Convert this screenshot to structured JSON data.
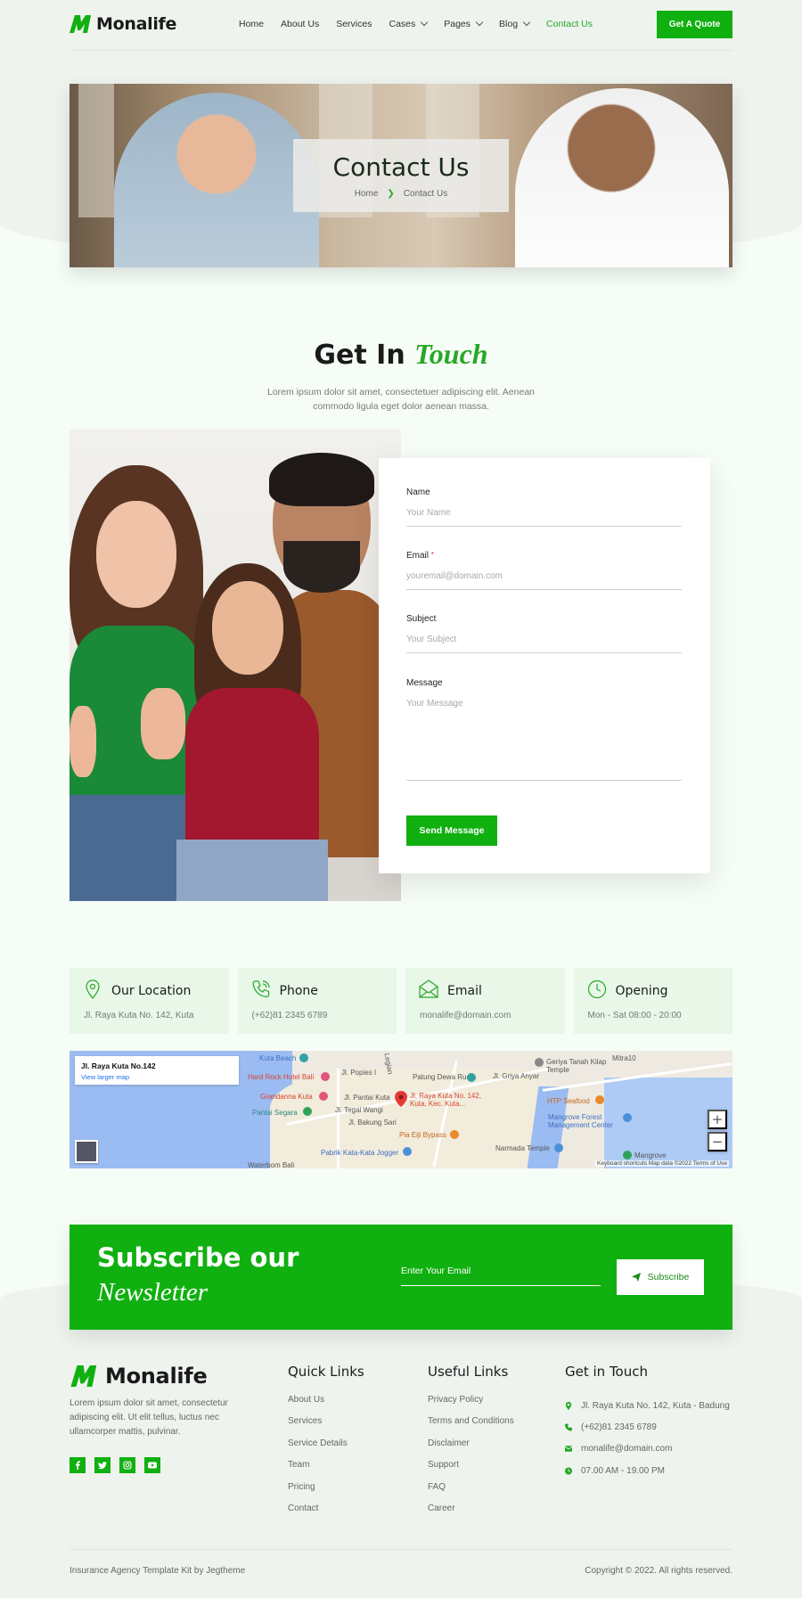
{
  "brand": {
    "name": "Monalife",
    "accent": "#10b010"
  },
  "nav": {
    "items": [
      {
        "label": "Home"
      },
      {
        "label": "About Us"
      },
      {
        "label": "Services"
      },
      {
        "label": "Cases"
      },
      {
        "label": "Pages"
      },
      {
        "label": "Blog"
      },
      {
        "label": "Contact Us"
      }
    ],
    "active": "Contact Us",
    "cta_label": "Get A Quote"
  },
  "hero": {
    "title": "Contact Us",
    "breadcrumb": [
      "Home",
      "Contact Us"
    ]
  },
  "get_in_touch": {
    "title": "Get In",
    "title_accent": "Touch",
    "description": "Lorem ipsum dolor sit amet, consectetuer adipiscing elit. Aenean commodo ligula eget dolor aenean massa."
  },
  "form": {
    "name_label": "Name",
    "name_placeholder": "Your Name",
    "email_label": "Email",
    "email_required_mark": "*",
    "email_placeholder": "youremail@domain.com",
    "subject_label": "Subject",
    "subject_placeholder": "Your Subject",
    "message_label": "Message",
    "message_placeholder": "Your Message",
    "submit_label": "Send Message"
  },
  "info_cards": [
    {
      "icon": "location-pin-icon",
      "title": "Our Location",
      "text": "Jl. Raya Kuta No. 142, Kuta"
    },
    {
      "icon": "phone-icon",
      "title": "Phone",
      "text": "(+62)81 2345 6789"
    },
    {
      "icon": "envelope-icon",
      "title": "Email",
      "text": "monalife@domain.com"
    },
    {
      "icon": "clock-icon",
      "title": "Opening",
      "text": "Mon - Sat 08:00 - 20:00"
    }
  ],
  "map": {
    "address": "Jl. Raya Kuta No.142",
    "larger_map_link": "View larger map",
    "pin_label": "Jl. Raya Kuta No. 142, Kuta, Kec. Kuta...",
    "places": [
      "Kuta Beach",
      "Hard Rock Hotel Bali",
      "Grandanna Kuta",
      "Pantai Segara",
      "Patung Dewa Ruci",
      "Geriya Tanah Kilap Temple",
      "Mitra10",
      "HTP Seafood",
      "Mangrove Forest Management Center",
      "Pia Eiji Bypass",
      "Pabrik Kata-Kata Jogger",
      "Narmada Temple",
      "Mangrove",
      "Waterbom Bali",
      "Jl. Pantai Kuta",
      "Jl. Tegal Wangi",
      "Jl. Bakung Sari",
      "Jl. Popies I",
      "Jl. Legian",
      "Jl. Griya Anyar"
    ],
    "zoom_in": "+",
    "zoom_out": "−",
    "attribution": "Keyboard shortcuts  Map data ©2022  Terms of Use"
  },
  "subscribe": {
    "title_line1": "Subscribe our",
    "title_line2": "Newsletter",
    "input_placeholder": "Enter Your Email",
    "button_label": "Subscribe"
  },
  "footer": {
    "about": "Lorem ipsum dolor sit amet, consectetur adipiscing elit. Ut elit tellus, luctus nec ullamcorper mattis, pulvinar.",
    "socials": [
      "facebook-icon",
      "twitter-icon",
      "instagram-icon",
      "youtube-icon"
    ],
    "quick_links_title": "Quick Links",
    "quick_links": [
      "About Us",
      "Services",
      "Service Details",
      "Team",
      "Pricing",
      "Contact"
    ],
    "useful_links_title": "Useful Links",
    "useful_links": [
      "Privacy Policy",
      "Terms and Conditions",
      "Disclaimer",
      "Support",
      "FAQ",
      "Career"
    ],
    "contact_title": "Get in Touch",
    "contact": [
      {
        "icon": "location-pin-icon",
        "text": "Jl. Raya Kuta No. 142, Kuta - Badung"
      },
      {
        "icon": "phone-icon",
        "text": "(+62)81 2345 6789"
      },
      {
        "icon": "envelope-icon",
        "text": "monalife@domain.com"
      },
      {
        "icon": "clock-icon",
        "text": "07.00 AM - 19.00 PM"
      }
    ],
    "credit": "Insurance Agency Template Kit by Jegtheme",
    "copyright": "Copyright © 2022. All rights reserved."
  }
}
